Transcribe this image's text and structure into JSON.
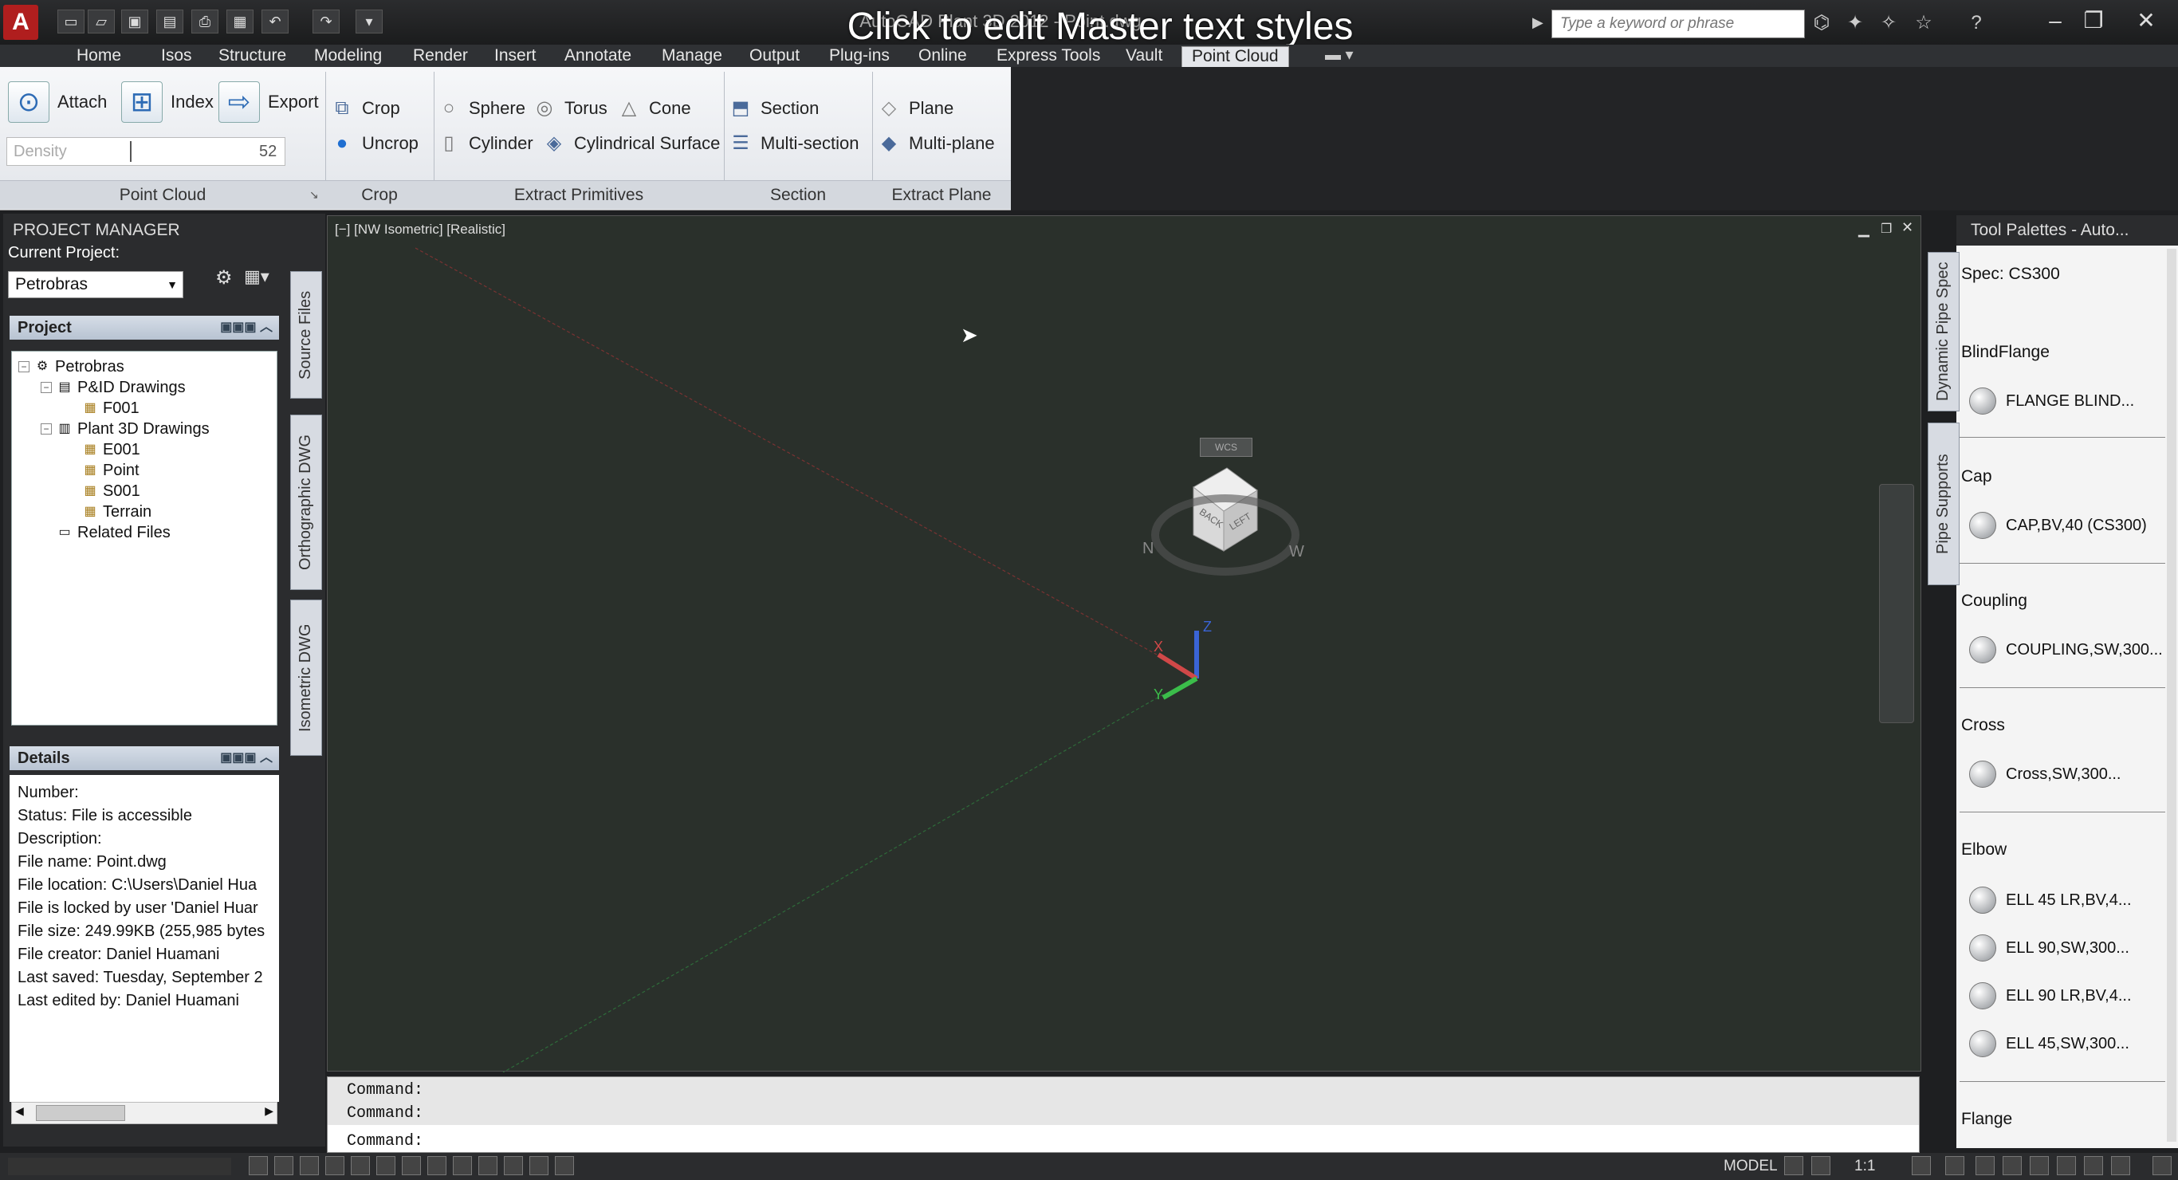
{
  "titlebar": {
    "app_title": "AutoCAD Plant 3D 2012 - Point.dwg",
    "overlay_title": "Click to edit Master text styles",
    "search_placeholder": "Type a keyword or phrase"
  },
  "ribbon": {
    "tabs": [
      "Home",
      "Isos",
      "Structure",
      "Modeling",
      "Render",
      "Insert",
      "Annotate",
      "Manage",
      "Output",
      "Plug-ins",
      "Online",
      "Express Tools",
      "Vault",
      "Point Cloud"
    ],
    "active_tab": "Point Cloud",
    "point_cloud": {
      "attach": "Attach",
      "index": "Index",
      "export": "Export",
      "density_label": "Density",
      "density_value": "52",
      "title": "Point Cloud"
    },
    "crop": {
      "crop": "Crop",
      "uncrop": "Uncrop",
      "title": "Crop"
    },
    "extract_primitives": {
      "sphere": "Sphere",
      "torus": "Torus",
      "cone": "Cone",
      "cylinder": "Cylinder",
      "cyl_surface": "Cylindrical Surface",
      "title": "Extract Primitives"
    },
    "section": {
      "section": "Section",
      "multi_section": "Multi-section",
      "title": "Section"
    },
    "extract_plane": {
      "plane": "Plane",
      "multi_plane": "Multi-plane",
      "title": "Extract Plane"
    }
  },
  "project_manager": {
    "title": "PROJECT MANAGER",
    "current_project_label": "Current Project:",
    "current_project": "Petrobras",
    "project_header": "Project",
    "tree": [
      {
        "label": "Petrobras",
        "level": 0
      },
      {
        "label": "P&ID Drawings",
        "level": 1
      },
      {
        "label": "F001",
        "level": 2
      },
      {
        "label": "Plant 3D Drawings",
        "level": 1
      },
      {
        "label": "E001",
        "level": 2
      },
      {
        "label": "Point",
        "level": 2
      },
      {
        "label": "S001",
        "level": 2
      },
      {
        "label": "Terrain",
        "level": 2
      },
      {
        "label": "Related Files",
        "level": 1
      }
    ],
    "details_header": "Details",
    "details": [
      "Number:",
      "Status: File is accessible",
      "Description:",
      "File name: Point.dwg",
      "File location: C:\\Users\\Daniel Hua",
      "File is locked by user 'Daniel Huar",
      "File size: 249.99KB (255,985 bytes",
      "File creator: Daniel Huamani",
      "Last saved: Tuesday, September 2",
      "Last edited by: Daniel Huamani"
    ],
    "side_tabs": [
      "Source Files",
      "Orthographic DWG",
      "Isometric DWG"
    ]
  },
  "viewport": {
    "label": "[−] [NW Isometric] [Realistic]",
    "wcs": "WCS",
    "cube_top": "BACK",
    "cube_side": "LEFT",
    "compass_n": "N",
    "compass_w": "W",
    "axis_z": "Z",
    "axis_x": "X",
    "axis_y": "Y"
  },
  "command": {
    "lines": [
      "Command:",
      "Command:"
    ],
    "prompt": "Command:"
  },
  "tool_palette": {
    "title": "Tool Palettes - Auto...",
    "side_tabs": [
      "Dynamic Pipe Spec",
      "Pipe Supports"
    ],
    "spec": "Spec: CS300",
    "sections": [
      {
        "name": "BlindFlange",
        "items": [
          "FLANGE BLIND..."
        ]
      },
      {
        "name": "Cap",
        "items": [
          "CAP,BV,40 (CS300)"
        ]
      },
      {
        "name": "Coupling",
        "items": [
          "COUPLING,SW,300..."
        ]
      },
      {
        "name": "Cross",
        "items": [
          "Cross,SW,300..."
        ]
      },
      {
        "name": "Elbow",
        "items": [
          "ELL 45 LR,BV,4...",
          "ELL 90,SW,300...",
          "ELL 90 LR,BV,4...",
          "ELL 45,SW,300..."
        ]
      },
      {
        "name": "Flange",
        "items": []
      }
    ]
  },
  "status": {
    "model": "MODEL",
    "scale": "1:1"
  }
}
